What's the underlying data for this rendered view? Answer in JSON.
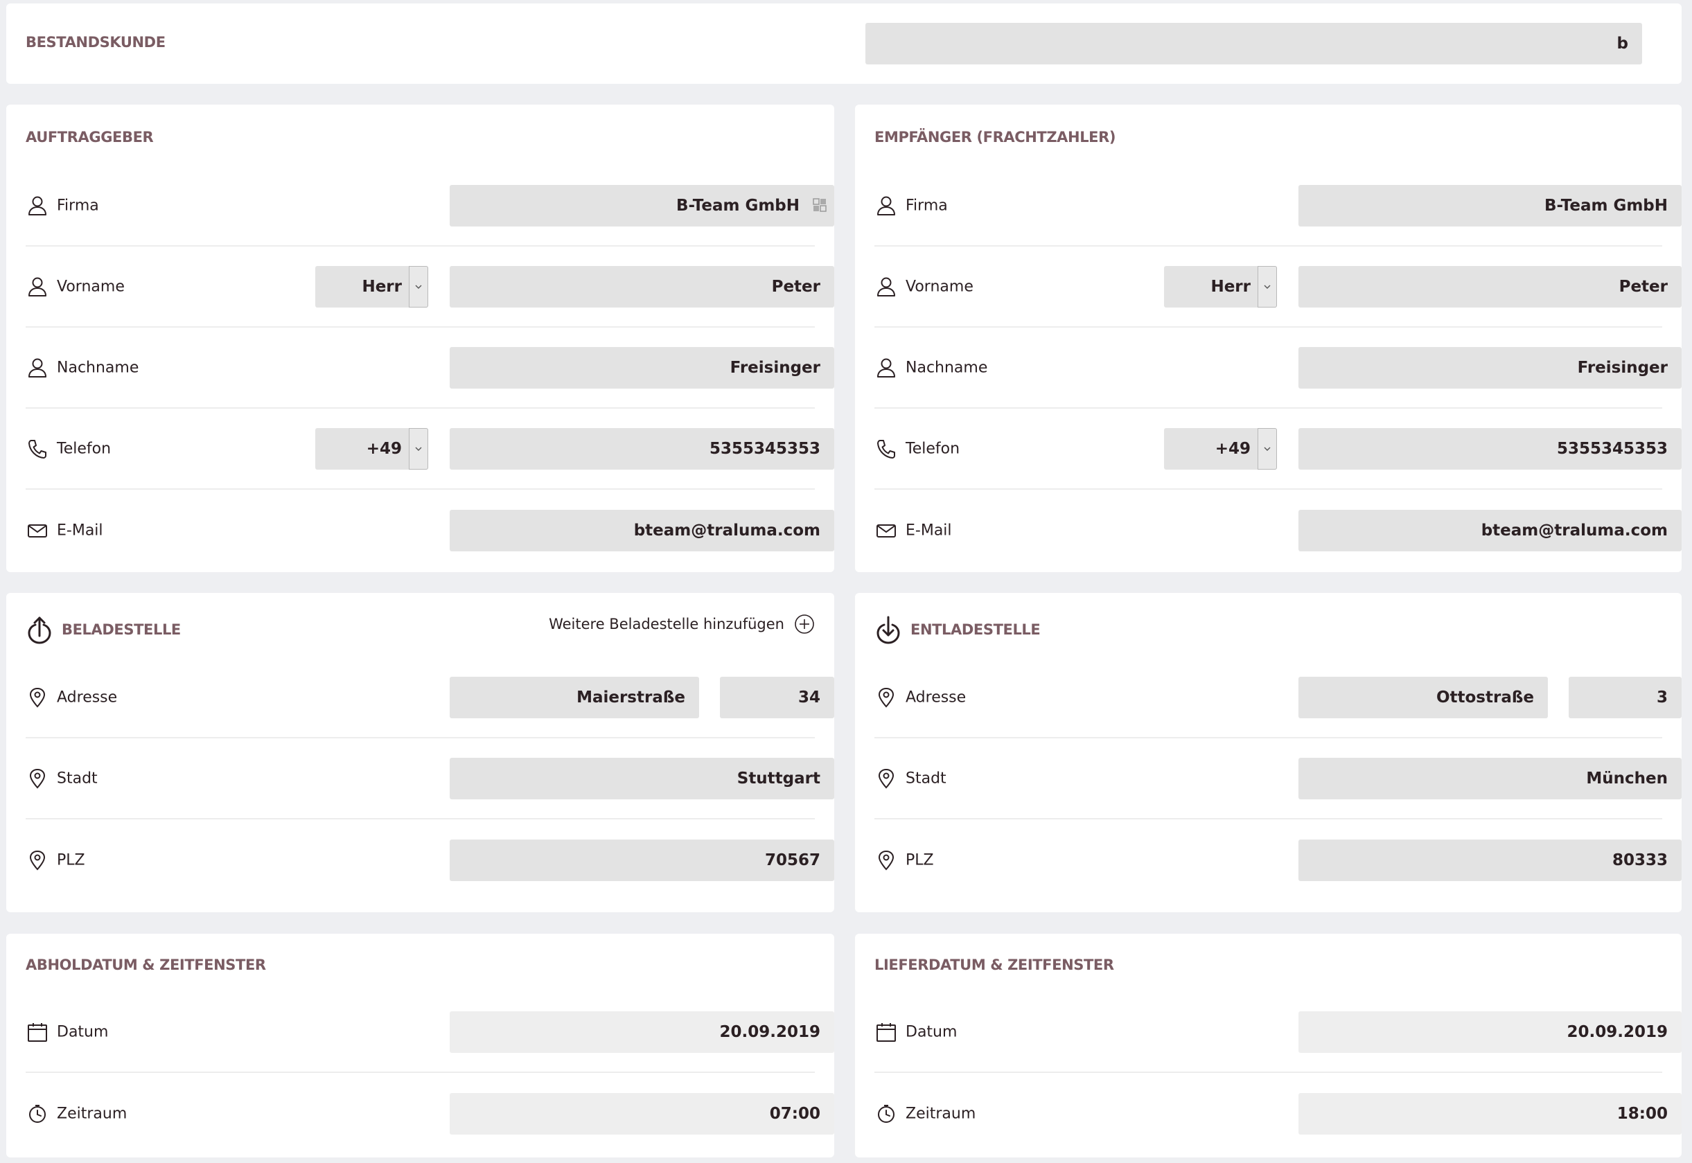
{
  "bestandskunde": {
    "title": "BESTANDSKUNDE",
    "value": "b"
  },
  "auftraggeber": {
    "title": "AUFTRAGGEBER",
    "firma_label": "Firma",
    "firma_value": "B-Team GmbH",
    "vorname_label": "Vorname",
    "anrede": "Herr",
    "vorname_value": "Peter",
    "nachname_label": "Nachname",
    "nachname_value": "Freisinger",
    "telefon_label": "Telefon",
    "vorwahl": "+49",
    "telefon_value": "5355345353",
    "email_label": "E-Mail",
    "email_value": "bteam@traluma.com"
  },
  "empfaenger": {
    "title": "EMPFÄNGER (FRACHTZAHLER)",
    "firma_label": "Firma",
    "firma_value": "B-Team GmbH",
    "vorname_label": "Vorname",
    "anrede": "Herr",
    "vorname_value": "Peter",
    "nachname_label": "Nachname",
    "nachname_value": "Freisinger",
    "telefon_label": "Telefon",
    "vorwahl": "+49",
    "telefon_value": "5355345353",
    "email_label": "E-Mail",
    "email_value": "bteam@traluma.com"
  },
  "beladestelle": {
    "title": "BELADESTELLE",
    "add_label": "Weitere Beladestelle hinzufügen",
    "adresse_label": "Adresse",
    "strasse": "Maierstraße",
    "hausnummer": "34",
    "stadt_label": "Stadt",
    "stadt_value": "Stuttgart",
    "plz_label": "PLZ",
    "plz_value": "70567"
  },
  "entladestelle": {
    "title": "ENTLADESTELLE",
    "adresse_label": "Adresse",
    "strasse": "Ottostraße",
    "hausnummer": "3",
    "stadt_label": "Stadt",
    "stadt_value": "München",
    "plz_label": "PLZ",
    "plz_value": "80333"
  },
  "abholdatum": {
    "title": "ABHOLDATUM & ZEITFENSTER",
    "datum_label": "Datum",
    "datum_value": "20.09.2019",
    "zeitraum_label": "Zeitraum",
    "zeitraum_value": "07:00"
  },
  "lieferdatum": {
    "title": "LIEFERDATUM & ZEITFENSTER",
    "datum_label": "Datum",
    "datum_value": "20.09.2019",
    "zeitraum_label": "Zeitraum",
    "zeitraum_value": "18:00"
  },
  "colors": {
    "heading": "#7a5c63",
    "text": "#2b2023",
    "field": "#e3e3e3",
    "background": "#eeeff2"
  }
}
